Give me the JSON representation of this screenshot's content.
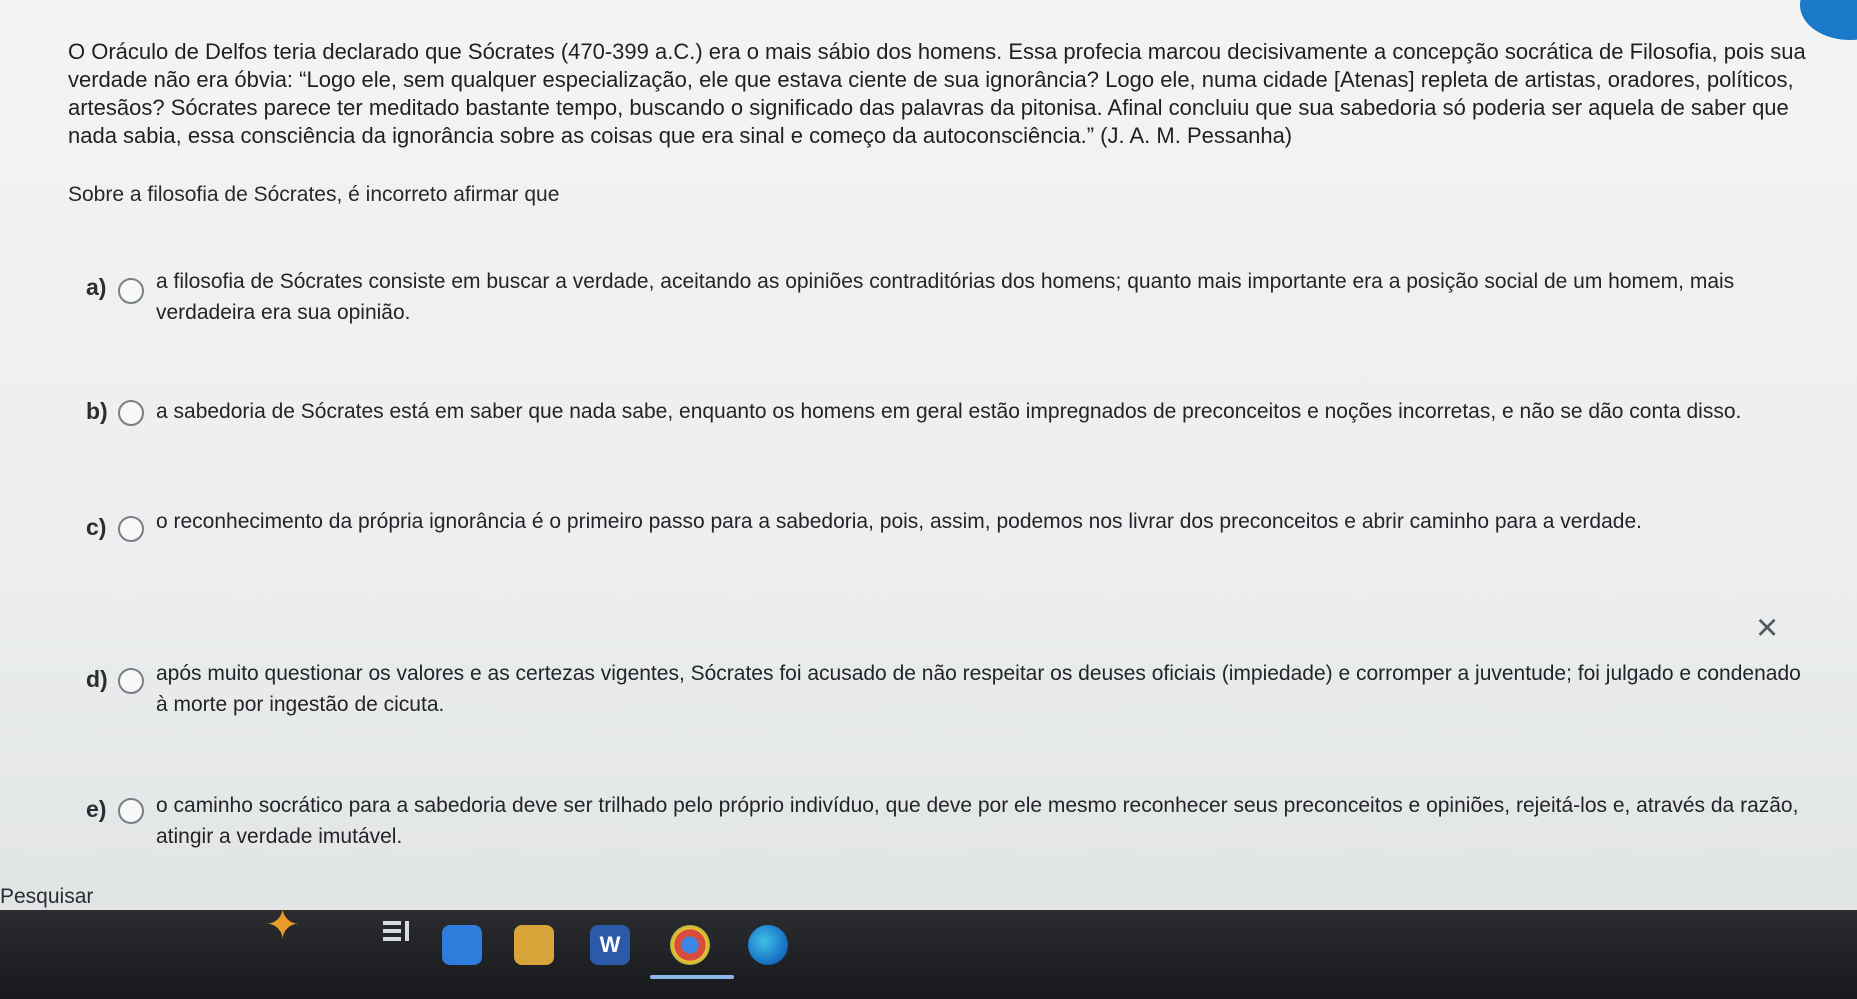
{
  "question": {
    "text": "O Oráculo de Delfos teria declarado que Sócrates (470-399 a.C.) era o mais sábio dos homens. Essa profecia marcou decisivamente a concepção socrática de Filosofia, pois sua verdade não era óbvia: “Logo ele, sem qualquer especialização, ele que estava ciente de sua ignorância? Logo ele, numa cidade [Atenas] repleta de artistas, oradores, políticos, artesãos? Sócrates parece ter meditado bastante tempo, buscando o significado das palavras da pitonisa. Afinal concluiu que sua sabedoria só poderia ser aquela de saber que nada sabia, essa consciência da ignorância sobre as coisas que era sinal e começo da autoconsciência.” (J. A. M. Pessanha)",
    "prompt": "Sobre a filosofia de Sócrates, é incorreto afirmar que"
  },
  "options": [
    {
      "letter": "a)",
      "text": "a filosofia de Sócrates consiste em buscar a verdade, aceitando as opiniões contraditórias dos homens; quanto mais importante era a posição social de um homem, mais verdadeira era sua opinião."
    },
    {
      "letter": "b)",
      "text": "a sabedoria de Sócrates está em saber que nada sabe, enquanto os homens em geral estão impregnados de preconceitos e noções incorretas, e não se dão conta disso."
    },
    {
      "letter": "c)",
      "text": "o reconhecimento da própria ignorância é o primeiro passo para a sabedoria, pois, assim, podemos nos livrar dos preconceitos e abrir caminho para a verdade."
    },
    {
      "letter": "d)",
      "text": "após muito questionar os valores e as certezas vigentes, Sócrates foi acusado de não respeitar os deuses oficiais (impiedade) e corromper a juventude; foi julgado e condenado à morte por ingestão de cicuta."
    },
    {
      "letter": "e)",
      "text": "o caminho socrático para a sabedoria deve ser trilhado pelo próprio indivíduo, que deve por ele mesmo reconhecer seus preconceitos e opiniões, rejeitá-los e, através da razão, atingir a verdade imutável."
    }
  ],
  "close_symbol": "×",
  "taskbar": {
    "search_label": "Pesquisar",
    "star_glyph": "✦",
    "taskview_glyph": "⧉",
    "word_letter": "W"
  }
}
